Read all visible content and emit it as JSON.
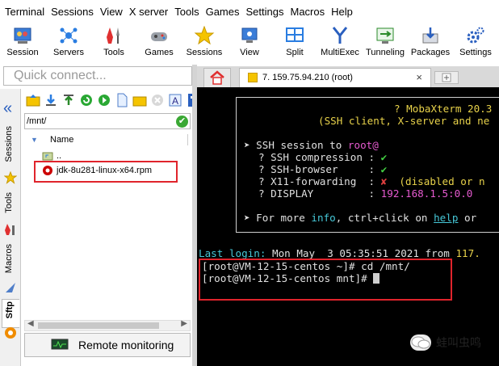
{
  "menu": [
    "Terminal",
    "Sessions",
    "View",
    "X server",
    "Tools",
    "Games",
    "Settings",
    "Macros",
    "Help"
  ],
  "toolbar": {
    "session": "Session",
    "servers": "Servers",
    "tools": "Tools",
    "games": "Games",
    "sessions": "Sessions",
    "view": "View",
    "split": "Split",
    "multiexec": "MultiExec",
    "tunneling": "Tunneling",
    "packages": "Packages",
    "settings": "Settings"
  },
  "quick_connect": {
    "placeholder": "Quick connect..."
  },
  "side_tabs": {
    "sessions": "Sessions",
    "tools": "Tools",
    "macros": "Macros",
    "sftp": "Sftp"
  },
  "sftp": {
    "path": "/mnt/",
    "column_name": "Name",
    "files": [
      {
        "name": ".."
      },
      {
        "name": "jdk-8u281-linux-x64.rpm"
      }
    ],
    "remote_monitoring": "Remote monitoring"
  },
  "tab": {
    "label": "7. 159.75.94.210 (root)",
    "close": "×"
  },
  "terminal": {
    "banner_title": "? MobaXterm 20.3",
    "banner_sub": "(SSH client, X-server and ne",
    "ssh_session_prefix": "SSH session to ",
    "ssh_user": "root@",
    "compression_label": "? SSH compression : ",
    "compression_val": "✔",
    "browser_label": "? SSH-browser     : ",
    "browser_val": "✔",
    "x11_label": "? X11-forwarding  : ",
    "x11_mark": "✘",
    "x11_val": "  (disabled or n",
    "display_label": "? DISPLAY         : ",
    "display_val": "192.168.1.5:0.0",
    "more_prefix": "For more ",
    "more_info": "info",
    "more_mid": ", ctrl+click on ",
    "more_help": "help",
    "more_suffix": " or ",
    "last_login_label": "Last login:",
    "last_login_val": " Mon May  3 05:35:51 2021 from ",
    "last_login_ip": "117.",
    "cmd1": "[root@VM-12-15-centos ~]# cd /mnt/",
    "cmd2": "[root@VM-12-15-centos mnt]# "
  },
  "watermark": "蛙叫虫鸣"
}
